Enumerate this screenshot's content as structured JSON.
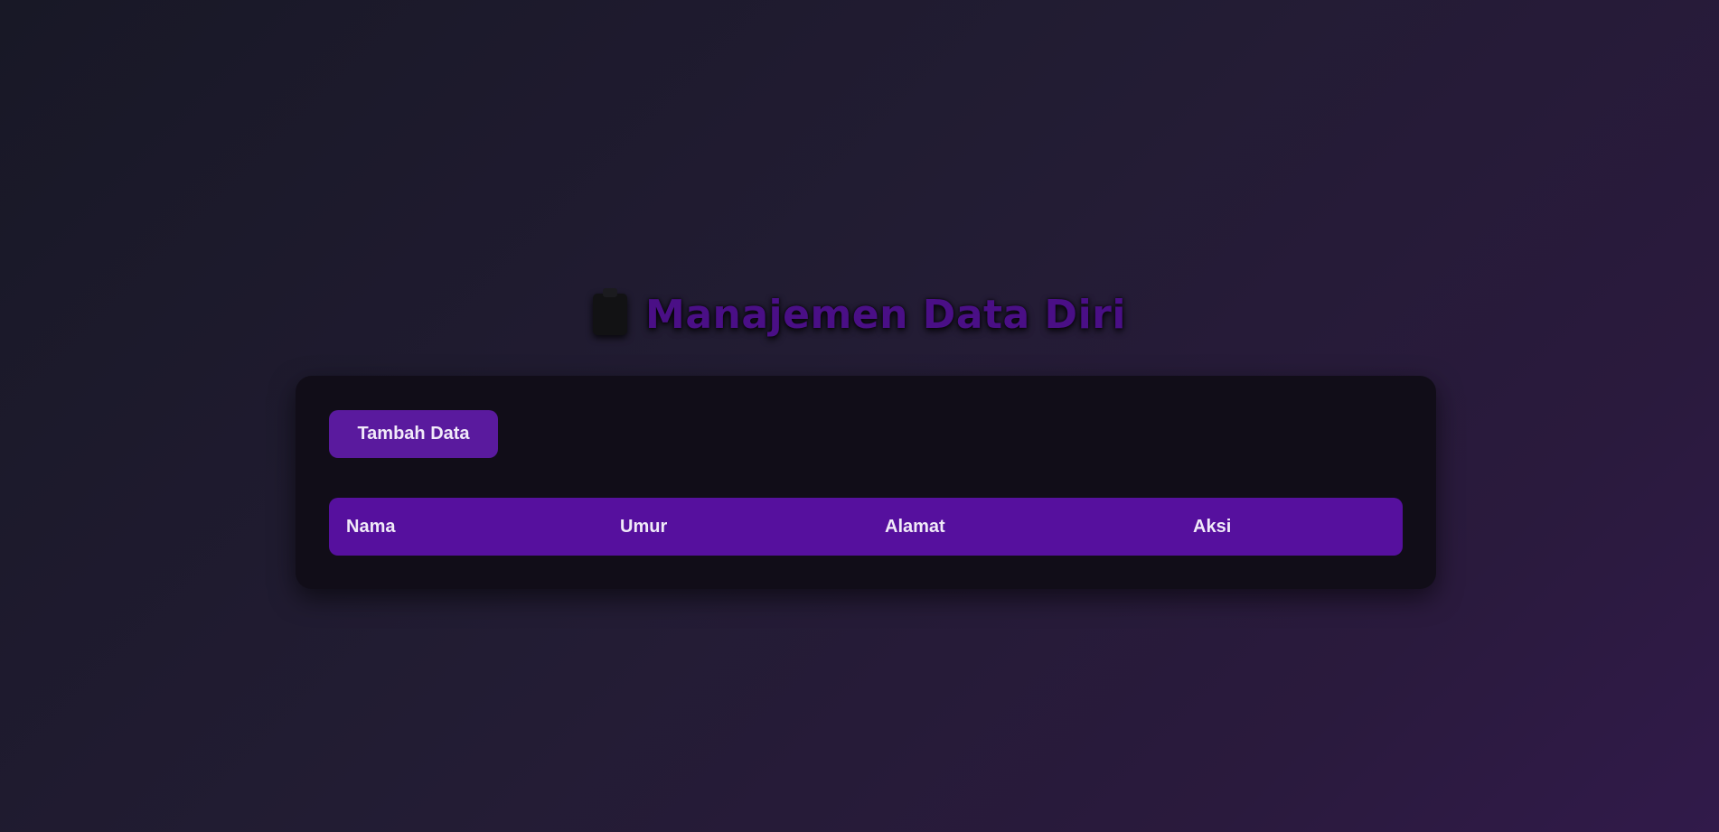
{
  "header": {
    "title": "Manajemen Data Diri",
    "icon": "clipboard-icon",
    "title_color": "#4a0f86"
  },
  "toolbar": {
    "add_label": "Tambah Data"
  },
  "table": {
    "columns": [
      "Nama",
      "Umur",
      "Alamat",
      "Aksi"
    ],
    "rows": []
  },
  "colors": {
    "accent": "#56109e",
    "card_background": "#110d18"
  }
}
